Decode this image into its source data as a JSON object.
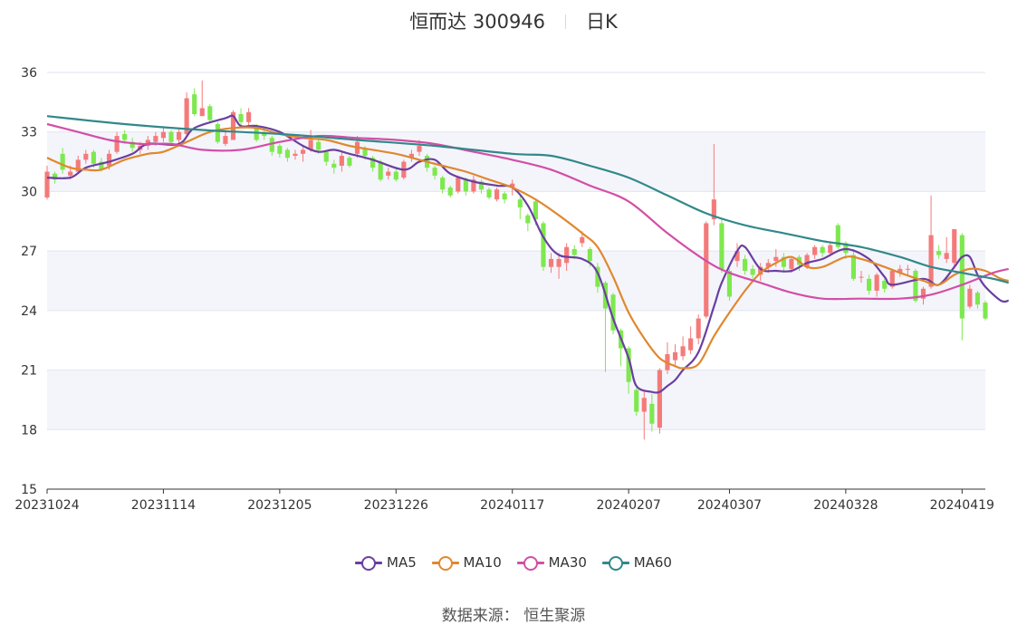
{
  "title": {
    "name": "恒而达 300946",
    "period": "日K"
  },
  "source": "数据来源： 恒生聚源",
  "colors": {
    "up": "#f47a7a",
    "down": "#7ee84e",
    "grid": "#e1e4ef",
    "band": "#f4f5fb",
    "axis": "#333333"
  },
  "chart_data": {
    "type": "candlestick",
    "ylim": [
      15,
      36
    ],
    "yticks": [
      15,
      18,
      21,
      24,
      27,
      30,
      33,
      36
    ],
    "xticks": [
      "20231024",
      "20231114",
      "20231205",
      "20231226",
      "20240117",
      "20240207",
      "20240307",
      "20240328",
      "20240419"
    ],
    "xtick_index": [
      0,
      15,
      30,
      45,
      60,
      75,
      88,
      103,
      118
    ],
    "grid": true,
    "legend_position": "bottom-center",
    "candles": [
      [
        29.7,
        31.0,
        31.3,
        29.6
      ],
      [
        30.9,
        30.6,
        31.0,
        30.4
      ],
      [
        31.9,
        31.1,
        32.2,
        30.9
      ],
      [
        30.8,
        31.0,
        31.3,
        30.6
      ],
      [
        31.0,
        31.6,
        31.8,
        30.9
      ],
      [
        31.6,
        31.9,
        32.1,
        31.4
      ],
      [
        32.0,
        31.4,
        32.1,
        31.2
      ],
      [
        31.5,
        31.1,
        31.7,
        31.0
      ],
      [
        31.3,
        31.9,
        32.1,
        31.1
      ],
      [
        32.0,
        32.8,
        33.0,
        31.9
      ],
      [
        32.9,
        32.6,
        33.1,
        32.4
      ],
      [
        32.5,
        32.2,
        32.7,
        32.0
      ],
      [
        32.1,
        32.3,
        32.5,
        31.9
      ],
      [
        32.3,
        32.6,
        32.8,
        32.1
      ],
      [
        32.5,
        32.8,
        33.0,
        32.3
      ],
      [
        32.7,
        33.0,
        33.3,
        32.5
      ],
      [
        33.0,
        32.5,
        33.1,
        32.3
      ],
      [
        32.6,
        33.0,
        33.2,
        32.4
      ],
      [
        32.9,
        34.7,
        35.0,
        32.7
      ],
      [
        34.9,
        33.9,
        35.2,
        33.8
      ],
      [
        33.8,
        34.2,
        35.6,
        33.9
      ],
      [
        34.3,
        33.6,
        34.4,
        33.5
      ],
      [
        33.4,
        32.5,
        33.5,
        32.4
      ],
      [
        32.4,
        32.8,
        33.0,
        32.3
      ],
      [
        32.6,
        34.0,
        34.1,
        32.6
      ],
      [
        33.9,
        33.5,
        34.2,
        33.3
      ],
      [
        33.5,
        34.0,
        34.2,
        33.2
      ],
      [
        33.2,
        32.6,
        33.4,
        32.5
      ],
      [
        33.0,
        32.8,
        33.2,
        32.6
      ],
      [
        32.7,
        32.0,
        32.8,
        31.8
      ],
      [
        32.3,
        31.9,
        32.4,
        31.7
      ],
      [
        32.1,
        31.7,
        32.2,
        31.5
      ],
      [
        31.8,
        31.9,
        32.1,
        31.6
      ],
      [
        31.9,
        32.1,
        32.3,
        31.5
      ],
      [
        32.1,
        32.6,
        33.1,
        32.0
      ],
      [
        32.5,
        32.1,
        32.6,
        31.9
      ],
      [
        32.0,
        31.5,
        32.1,
        31.3
      ],
      [
        31.4,
        31.2,
        31.6,
        30.9
      ],
      [
        31.3,
        31.8,
        32.0,
        31.0
      ],
      [
        31.7,
        31.3,
        31.8,
        31.2
      ],
      [
        31.9,
        32.5,
        32.8,
        31.7
      ],
      [
        32.2,
        31.8,
        32.3,
        31.6
      ],
      [
        31.7,
        31.2,
        31.8,
        31.0
      ],
      [
        31.5,
        30.6,
        31.6,
        30.5
      ],
      [
        30.8,
        31.0,
        31.2,
        30.6
      ],
      [
        31.0,
        30.6,
        31.2,
        30.5
      ],
      [
        30.7,
        31.5,
        31.6,
        30.6
      ],
      [
        31.7,
        31.9,
        32.1,
        31.5
      ],
      [
        32.0,
        32.3,
        32.6,
        31.8
      ],
      [
        31.8,
        31.2,
        31.9,
        31.0
      ],
      [
        31.2,
        30.8,
        31.3,
        30.6
      ],
      [
        30.7,
        30.1,
        30.8,
        29.9
      ],
      [
        30.2,
        29.8,
        30.3,
        29.7
      ],
      [
        30.0,
        30.7,
        30.8,
        29.9
      ],
      [
        30.6,
        30.0,
        30.7,
        29.8
      ],
      [
        30.0,
        30.6,
        30.8,
        29.9
      ],
      [
        30.5,
        30.1,
        30.6,
        29.9
      ],
      [
        30.1,
        29.7,
        30.2,
        29.6
      ],
      [
        29.6,
        30.1,
        30.2,
        29.5
      ],
      [
        29.9,
        29.6,
        30.0,
        29.4
      ],
      [
        30.2,
        30.4,
        30.6,
        29.8
      ],
      [
        29.6,
        29.2,
        29.8,
        28.6
      ],
      [
        28.8,
        28.4,
        28.9,
        28.0
      ],
      [
        29.5,
        28.6,
        29.6,
        28.3
      ],
      [
        28.4,
        26.2,
        28.5,
        26.0
      ],
      [
        26.2,
        26.6,
        26.9,
        25.9
      ],
      [
        26.2,
        26.6,
        26.9,
        25.6
      ],
      [
        26.4,
        27.2,
        27.4,
        26.0
      ],
      [
        27.1,
        26.8,
        27.3,
        26.6
      ],
      [
        27.4,
        27.7,
        28.0,
        27.2
      ],
      [
        27.1,
        26.5,
        27.2,
        26.2
      ],
      [
        26.2,
        25.2,
        26.4,
        24.9
      ],
      [
        25.4,
        24.1,
        25.5,
        20.9
      ],
      [
        24.8,
        23.0,
        24.9,
        22.8
      ],
      [
        23.0,
        22.1,
        23.1,
        21.2
      ],
      [
        22.1,
        20.4,
        22.2,
        19.8
      ],
      [
        20.0,
        18.9,
        20.1,
        18.7
      ],
      [
        18.9,
        19.6,
        19.9,
        17.5
      ],
      [
        19.3,
        18.3,
        19.8,
        17.9
      ],
      [
        18.1,
        21.0,
        21.1,
        17.8
      ],
      [
        21.0,
        21.8,
        22.4,
        20.8
      ],
      [
        21.5,
        21.9,
        22.3,
        21.2
      ],
      [
        21.7,
        22.2,
        22.7,
        21.5
      ],
      [
        22.0,
        22.6,
        23.2,
        21.8
      ],
      [
        22.6,
        23.6,
        23.8,
        22.3
      ],
      [
        23.7,
        28.4,
        28.5,
        23.6
      ],
      [
        28.6,
        29.6,
        32.4,
        28.3
      ],
      [
        28.4,
        26.1,
        28.6,
        25.9
      ],
      [
        26.0,
        24.7,
        26.1,
        24.5
      ],
      [
        26.5,
        27.0,
        27.4,
        26.2
      ],
      [
        26.6,
        26.0,
        26.8,
        25.8
      ],
      [
        26.1,
        25.8,
        26.3,
        25.6
      ],
      [
        25.8,
        26.2,
        26.4,
        25.5
      ],
      [
        26.2,
        26.4,
        26.6,
        25.9
      ],
      [
        26.5,
        26.7,
        27.1,
        26.2
      ],
      [
        26.7,
        26.2,
        26.9,
        25.9
      ],
      [
        26.1,
        26.6,
        26.7,
        25.9
      ],
      [
        26.7,
        26.3,
        26.8,
        26.0
      ],
      [
        26.2,
        26.8,
        26.9,
        26.1
      ],
      [
        26.8,
        27.2,
        27.3,
        26.6
      ],
      [
        27.2,
        26.9,
        27.3,
        26.7
      ],
      [
        26.9,
        27.3,
        27.5,
        26.8
      ],
      [
        28.3,
        27.2,
        28.4,
        27.1
      ],
      [
        27.4,
        26.9,
        27.5,
        26.6
      ],
      [
        26.8,
        25.6,
        27.0,
        25.5
      ],
      [
        25.7,
        25.7,
        26.0,
        25.4
      ],
      [
        25.6,
        25.0,
        25.8,
        24.8
      ],
      [
        25.0,
        25.8,
        25.9,
        24.7
      ],
      [
        25.5,
        25.1,
        25.6,
        24.9
      ],
      [
        25.2,
        26.0,
        26.1,
        25.1
      ],
      [
        25.9,
        26.1,
        26.3,
        25.7
      ],
      [
        26.1,
        26.1,
        26.3,
        25.8
      ],
      [
        26.0,
        24.5,
        26.1,
        24.4
      ],
      [
        24.6,
        25.1,
        25.2,
        24.3
      ],
      [
        25.2,
        27.8,
        29.8,
        25.1
      ],
      [
        27.0,
        26.8,
        27.3,
        26.6
      ],
      [
        26.6,
        26.9,
        27.7,
        26.4
      ],
      [
        26.4,
        28.1,
        28.1,
        26.1
      ],
      [
        27.8,
        23.6,
        27.9,
        22.5
      ],
      [
        24.2,
        25.1,
        25.3,
        24.1
      ],
      [
        24.9,
        24.3,
        25.0,
        24.1
      ],
      [
        24.4,
        23.6,
        24.5,
        23.5
      ]
    ],
    "series": [
      {
        "name": "MA5",
        "color": "#6a3fa0",
        "values": [
          [
            0,
            30.7
          ],
          [
            3,
            30.7
          ],
          [
            5,
            31.2
          ],
          [
            8,
            31.5
          ],
          [
            11,
            31.9
          ],
          [
            13,
            32.4
          ],
          [
            17,
            32.4
          ],
          [
            19,
            33.2
          ],
          [
            23,
            33.7
          ],
          [
            24,
            33.8
          ],
          [
            25,
            33.3
          ],
          [
            27,
            33.3
          ],
          [
            30,
            33.0
          ],
          [
            33,
            32.3
          ],
          [
            35,
            32.0
          ],
          [
            37,
            32.1
          ],
          [
            39,
            31.9
          ],
          [
            42,
            31.6
          ],
          [
            46,
            31.1
          ],
          [
            48,
            31.5
          ],
          [
            50,
            31.6
          ],
          [
            52,
            30.9
          ],
          [
            55,
            30.5
          ],
          [
            58,
            30.3
          ],
          [
            60,
            30.2
          ],
          [
            62,
            29.3
          ],
          [
            64,
            27.7
          ],
          [
            66,
            26.8
          ],
          [
            69,
            26.6
          ],
          [
            71,
            25.9
          ],
          [
            73,
            23.6
          ],
          [
            75,
            21.6
          ],
          [
            76,
            20.2
          ],
          [
            78,
            19.9
          ],
          [
            79,
            19.9
          ],
          [
            80,
            20.2
          ],
          [
            81,
            20.5
          ],
          [
            82,
            21.0
          ],
          [
            84,
            21.9
          ],
          [
            86,
            24.2
          ],
          [
            87,
            25.4
          ],
          [
            89,
            27.0
          ],
          [
            90,
            27.2
          ],
          [
            92,
            26.1
          ],
          [
            94,
            26.0
          ],
          [
            96,
            26.0
          ],
          [
            98,
            26.4
          ],
          [
            100,
            26.6
          ],
          [
            103,
            27.1
          ],
          [
            106,
            26.6
          ],
          [
            108,
            25.7
          ],
          [
            109,
            25.3
          ],
          [
            113,
            25.6
          ],
          [
            115,
            25.3
          ],
          [
            117,
            26.2
          ],
          [
            118,
            26.7
          ],
          [
            119,
            26.7
          ],
          [
            120,
            25.8
          ],
          [
            121,
            25.2
          ],
          [
            123,
            24.5
          ],
          [
            124,
            24.5
          ]
        ]
      },
      {
        "name": "MA10",
        "color": "#e0882e",
        "values": [
          [
            0,
            31.7
          ],
          [
            3,
            31.2
          ],
          [
            5,
            31.1
          ],
          [
            7,
            31.1
          ],
          [
            10,
            31.6
          ],
          [
            13,
            31.9
          ],
          [
            15,
            32.0
          ],
          [
            18,
            32.5
          ],
          [
            21,
            33.0
          ],
          [
            24,
            33.2
          ],
          [
            27,
            33.2
          ],
          [
            30,
            32.9
          ],
          [
            33,
            32.7
          ],
          [
            36,
            32.6
          ],
          [
            39,
            32.3
          ],
          [
            42,
            32.1
          ],
          [
            45,
            31.9
          ],
          [
            48,
            31.6
          ],
          [
            51,
            31.3
          ],
          [
            54,
            31.0
          ],
          [
            57,
            30.6
          ],
          [
            60,
            30.2
          ],
          [
            63,
            29.6
          ],
          [
            66,
            28.8
          ],
          [
            69,
            27.9
          ],
          [
            71,
            27.2
          ],
          [
            73,
            25.7
          ],
          [
            75,
            23.9
          ],
          [
            77,
            22.6
          ],
          [
            79,
            21.6
          ],
          [
            81,
            21.2
          ],
          [
            82,
            21.1
          ],
          [
            84,
            21.3
          ],
          [
            86,
            22.7
          ],
          [
            88,
            23.9
          ],
          [
            90,
            25.0
          ],
          [
            92,
            25.9
          ],
          [
            94,
            26.4
          ],
          [
            96,
            26.7
          ],
          [
            98,
            26.2
          ],
          [
            100,
            26.2
          ],
          [
            103,
            26.7
          ],
          [
            105,
            26.6
          ],
          [
            108,
            26.2
          ],
          [
            110,
            25.9
          ],
          [
            113,
            25.5
          ],
          [
            115,
            25.3
          ],
          [
            117,
            25.8
          ],
          [
            119,
            26.1
          ],
          [
            121,
            26.0
          ],
          [
            123,
            25.6
          ],
          [
            124,
            25.5
          ]
        ]
      },
      {
        "name": "MA30",
        "color": "#d24fa6",
        "values": [
          [
            0,
            33.4
          ],
          [
            4,
            33.0
          ],
          [
            8,
            32.6
          ],
          [
            12,
            32.4
          ],
          [
            16,
            32.4
          ],
          [
            20,
            32.1
          ],
          [
            25,
            32.1
          ],
          [
            30,
            32.5
          ],
          [
            35,
            32.8
          ],
          [
            40,
            32.7
          ],
          [
            45,
            32.6
          ],
          [
            50,
            32.4
          ],
          [
            55,
            32.0
          ],
          [
            60,
            31.6
          ],
          [
            65,
            31.1
          ],
          [
            70,
            30.3
          ],
          [
            75,
            29.5
          ],
          [
            80,
            27.9
          ],
          [
            85,
            26.5
          ],
          [
            88,
            25.9
          ],
          [
            92,
            25.4
          ],
          [
            96,
            24.9
          ],
          [
            100,
            24.6
          ],
          [
            105,
            24.6
          ],
          [
            110,
            24.6
          ],
          [
            114,
            24.8
          ],
          [
            118,
            25.3
          ],
          [
            122,
            25.9
          ],
          [
            124,
            26.1
          ]
        ]
      },
      {
        "name": "MA60",
        "color": "#32888a",
        "values": [
          [
            0,
            33.8
          ],
          [
            10,
            33.4
          ],
          [
            20,
            33.1
          ],
          [
            30,
            32.9
          ],
          [
            40,
            32.6
          ],
          [
            50,
            32.3
          ],
          [
            60,
            31.9
          ],
          [
            65,
            31.8
          ],
          [
            70,
            31.3
          ],
          [
            75,
            30.7
          ],
          [
            80,
            29.8
          ],
          [
            85,
            28.9
          ],
          [
            90,
            28.3
          ],
          [
            95,
            27.9
          ],
          [
            100,
            27.5
          ],
          [
            105,
            27.2
          ],
          [
            110,
            26.7
          ],
          [
            114,
            26.2
          ],
          [
            118,
            25.9
          ],
          [
            122,
            25.6
          ],
          [
            124,
            25.4
          ]
        ]
      }
    ]
  }
}
